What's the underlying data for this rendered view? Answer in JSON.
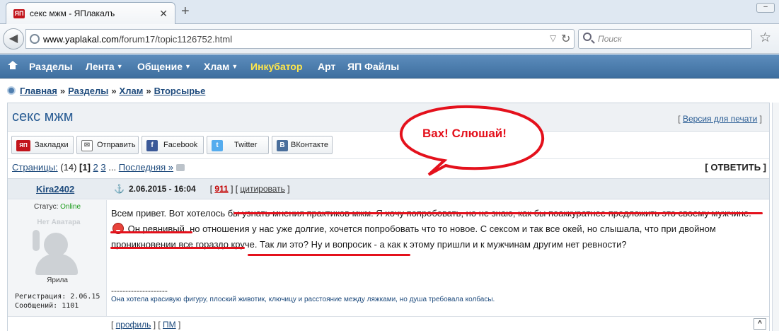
{
  "browser": {
    "tab_title": "секс мжм - ЯПлакалъ",
    "tab_favicon": "ЯП",
    "url_domain": "www.yaplakal.com",
    "url_path": "/forum17/topic1126752.html",
    "search_placeholder": "Поиск"
  },
  "menu": {
    "items": [
      {
        "label": "Разделы"
      },
      {
        "label": "Лента"
      },
      {
        "label": "Общение"
      },
      {
        "label": "Хлам"
      },
      {
        "label": "Инкубатор"
      },
      {
        "label": "Арт"
      },
      {
        "label": "ЯП Файлы"
      }
    ]
  },
  "breadcrumb": {
    "items": [
      "Главная",
      "Разделы",
      "Хлам",
      "Вторсырье"
    ],
    "sep": "»"
  },
  "topic": {
    "title": "секс мжм",
    "print_link": "Версия для печати"
  },
  "share": {
    "bookmarks": "Закладки",
    "send": "Отправить",
    "facebook": "Facebook",
    "twitter": "Twitter",
    "vk": "ВКонтакте",
    "ya_icon": "ЯП",
    "vk_icon": "B",
    "fb_icon": "f",
    "tw_icon": "t"
  },
  "pager": {
    "label": "Страницы:",
    "count": "(14)",
    "current": "[1]",
    "page2": "2",
    "page3": "3",
    "ellipsis": "...",
    "last": "Последняя »",
    "reply": "[ ОТВЕТИТЬ ]"
  },
  "post": {
    "author": "Kira2402",
    "date": "2.06.2015 - 16:04",
    "number": "911",
    "quote": "цитировать",
    "status_label": "Статус:",
    "status_value": "Online",
    "avatar_label": "Нет Аватара",
    "rank": "Ярила",
    "reg_label": "Регистрация:",
    "reg_date": "2.06.15",
    "msgs_label": "Сообщений:",
    "msgs_count": "1101",
    "body_part1": "Всем привет. Вот хотелось бы узнать мнения практиков мжм. Я хочу попробовать, но не знаю, как бы поаккуратнее предложить это своему мужчине.",
    "body_part2": "Он ревнивый, но отношения у нас уже долгие, хочется попробовать что то новое. С сексом и так все окей, но слышала, что при двойном проникновении все гораздо круче. Так ли это? Ну и вопросик - а как к этому пришли и к мужчинам другим нет ревности?",
    "sig_line": "--------------------",
    "signature": "Она хотела красивую фигуру, плоский животик, ключицу и расстояние между ляжками, но душа требовала колбасы.",
    "profile": "профиль",
    "pm": "ПМ",
    "to_top": "^"
  },
  "annotation": {
    "bubble_text": "Вах! Слюшай!",
    "color": "#e4111c"
  }
}
